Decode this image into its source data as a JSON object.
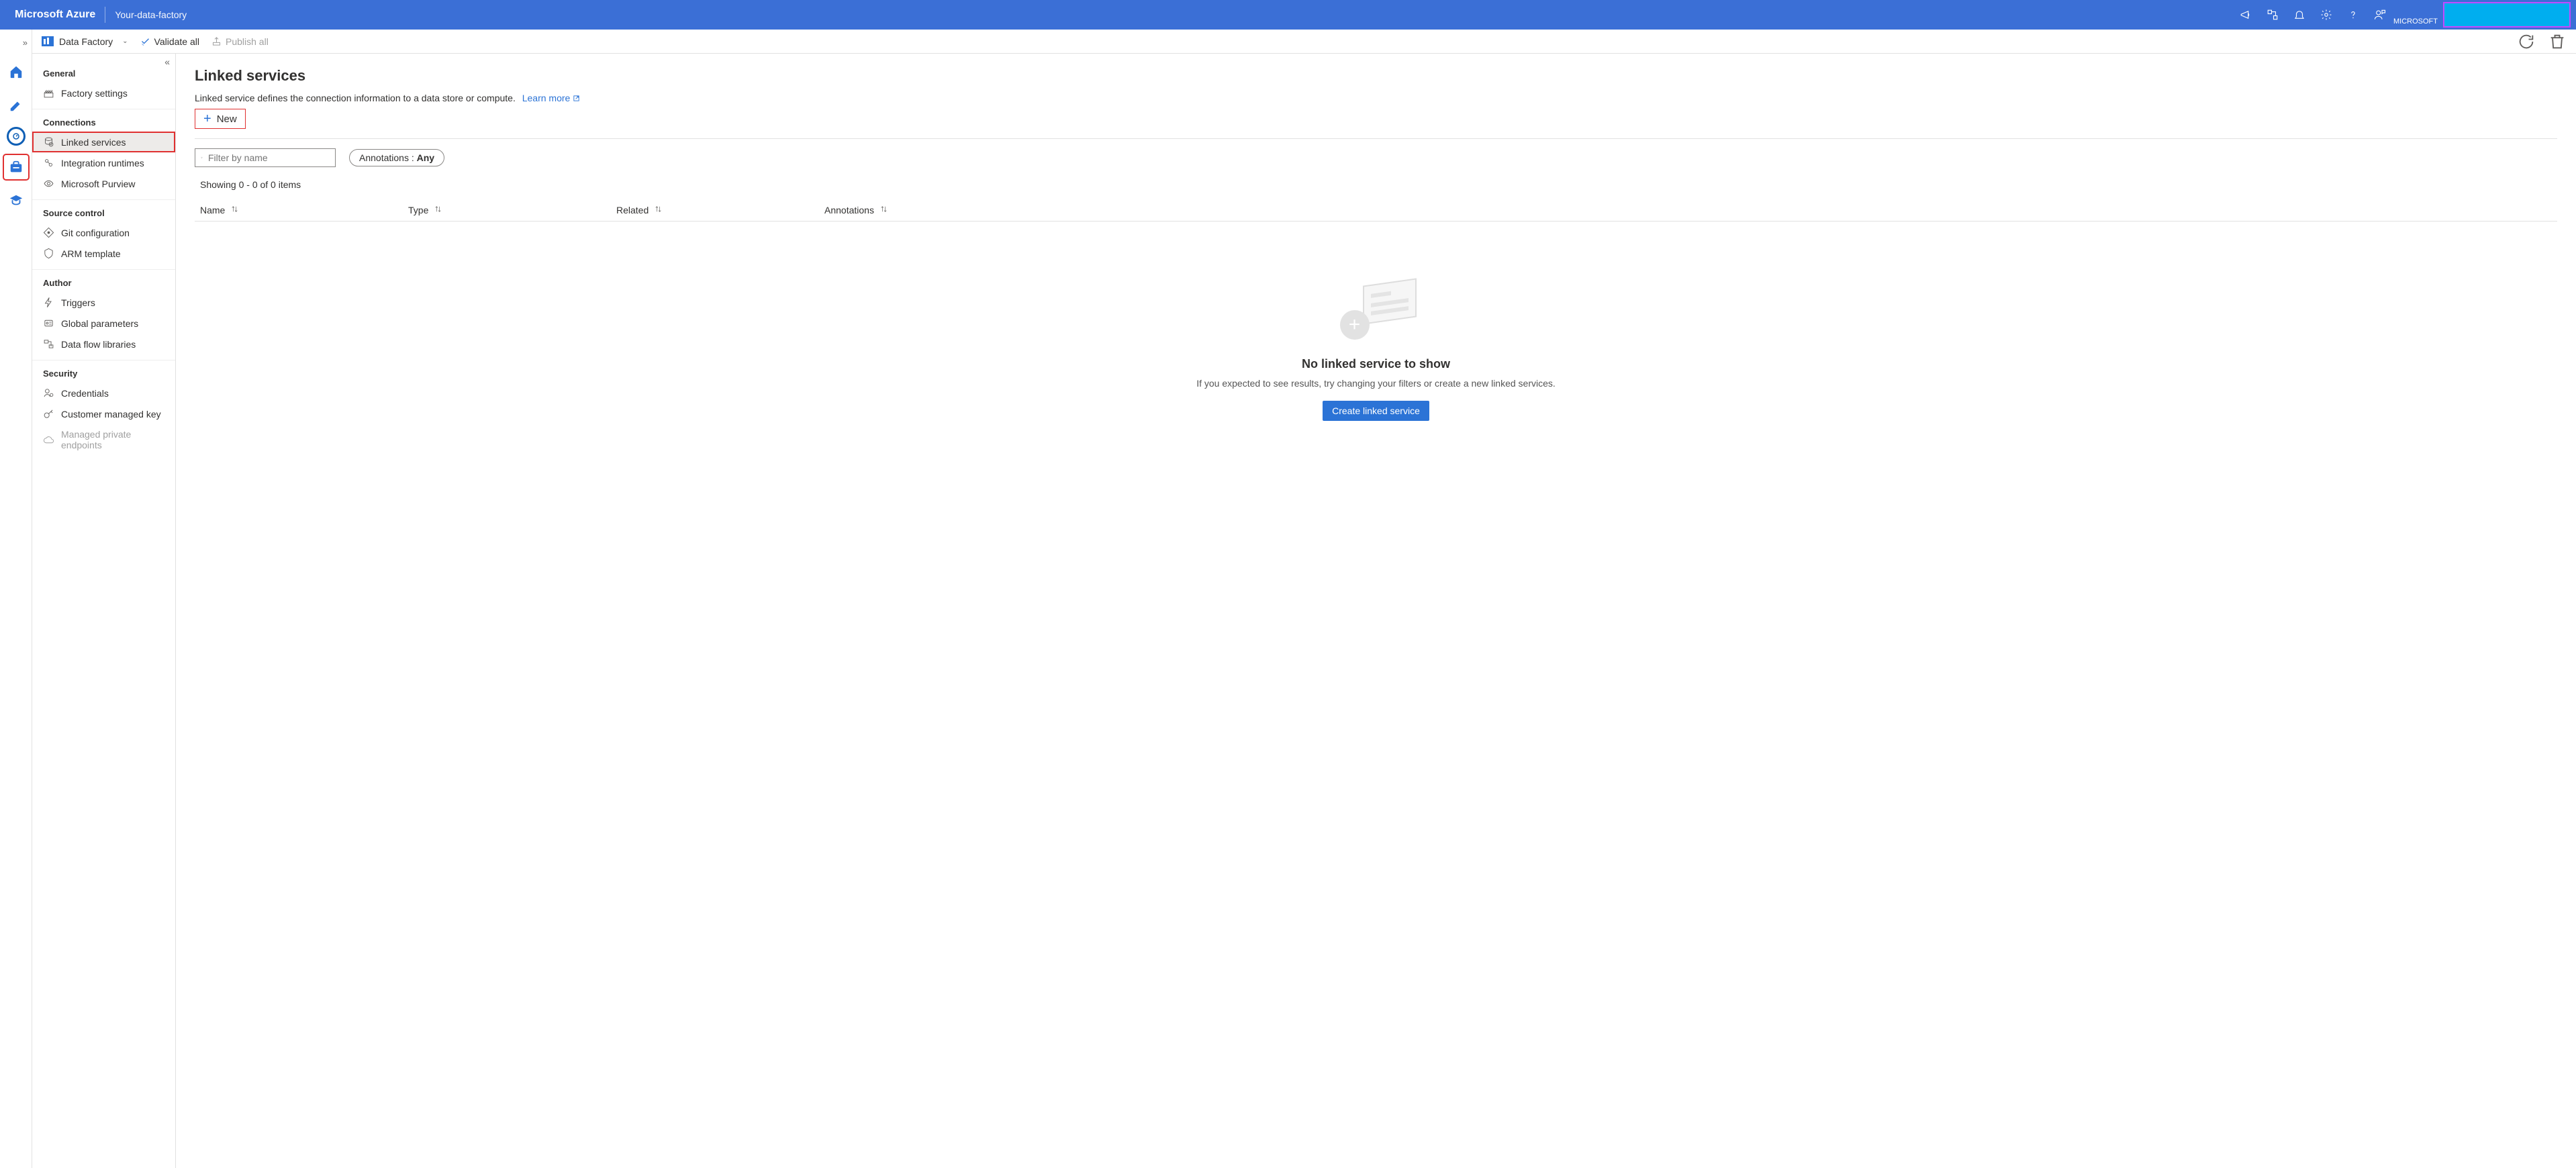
{
  "topbar": {
    "brand": "Microsoft Azure",
    "resource": "Your-data-factory",
    "tenant": "MICROSOFT"
  },
  "toolbar": {
    "pickerLabel": "Data Factory",
    "validateAll": "Validate all",
    "publishAll": "Publish all"
  },
  "nav": {
    "groups": {
      "general": "General",
      "connections": "Connections",
      "sourceControl": "Source control",
      "author": "Author",
      "security": "Security"
    },
    "items": {
      "factorySettings": "Factory settings",
      "linkedServices": "Linked services",
      "integrationRuntimes": "Integration runtimes",
      "microsoftPurview": "Microsoft Purview",
      "gitConfiguration": "Git configuration",
      "armTemplate": "ARM template",
      "triggers": "Triggers",
      "globalParameters": "Global parameters",
      "dataFlowLibraries": "Data flow libraries",
      "credentials": "Credentials",
      "customerManagedKey": "Customer managed key",
      "managedPrivateEndpoints": "Managed private endpoints"
    }
  },
  "main": {
    "title": "Linked services",
    "description": "Linked service defines the connection information to a data store or compute.",
    "learnMore": "Learn more",
    "newButton": "New",
    "filterPlaceholder": "Filter by name",
    "annotationsLabel": "Annotations : ",
    "annotationsValue": "Any",
    "showing": "Showing 0 - 0 of 0 items",
    "columns": {
      "name": "Name",
      "type": "Type",
      "related": "Related",
      "annotations": "Annotations"
    },
    "empty": {
      "heading": "No linked service to show",
      "text": "If you expected to see results, try changing your filters or create a new linked services.",
      "button": "Create linked service"
    }
  }
}
